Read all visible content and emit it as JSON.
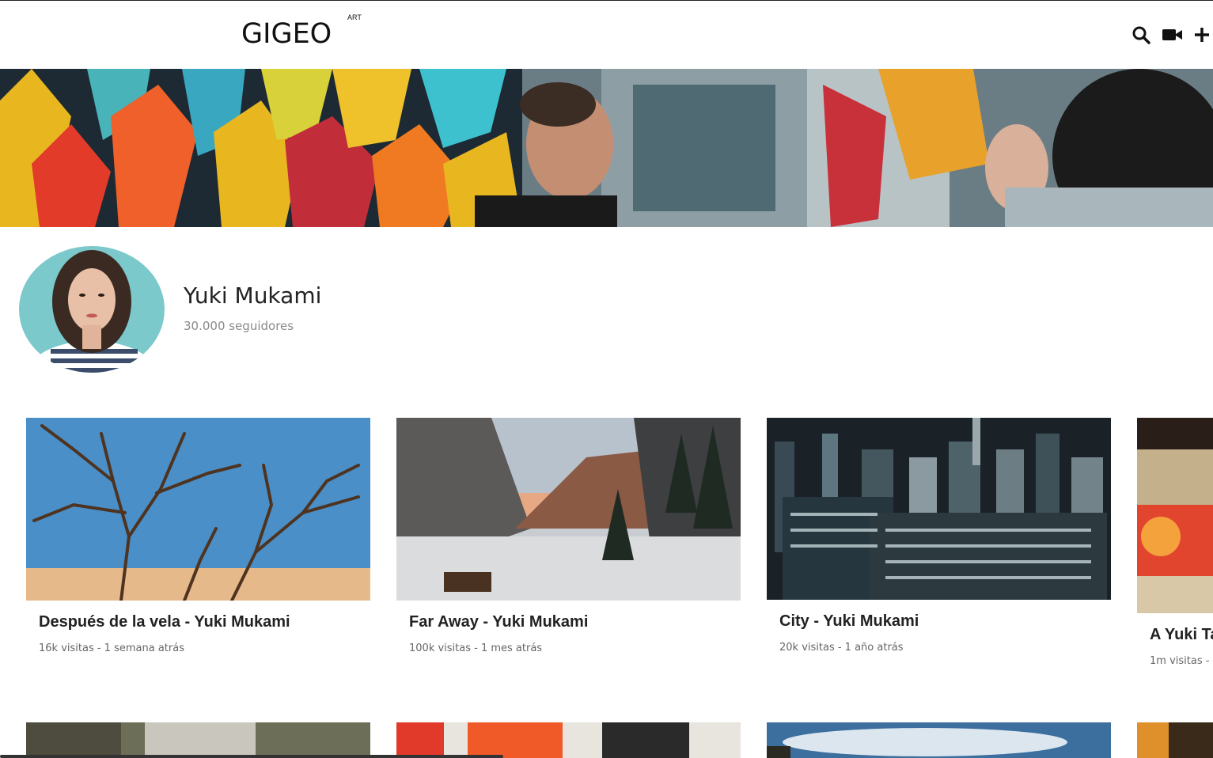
{
  "header": {
    "logo": "GIGEO",
    "logo_superscript": "ART",
    "icons": [
      "search-icon",
      "video-camera-icon",
      "plus-icon"
    ]
  },
  "profile": {
    "name": "Yuki Mukami",
    "followers": "30.000 seguidores"
  },
  "videos": [
    {
      "title": "Después de la vela - Yuki Mukami",
      "meta": "16k visitas - 1 semana atrás"
    },
    {
      "title": "Far Away - Yuki Mukami",
      "meta": "100k visitas - 1 mes atrás"
    },
    {
      "title": "City - Yuki Mukami",
      "meta": "20k visitas - 1 año atrás"
    },
    {
      "title": "A Yuki Ta",
      "meta": "1m visitas -"
    }
  ],
  "colors": {
    "text": "#222222",
    "muted": "#8a8a8a",
    "background": "#ffffff"
  }
}
